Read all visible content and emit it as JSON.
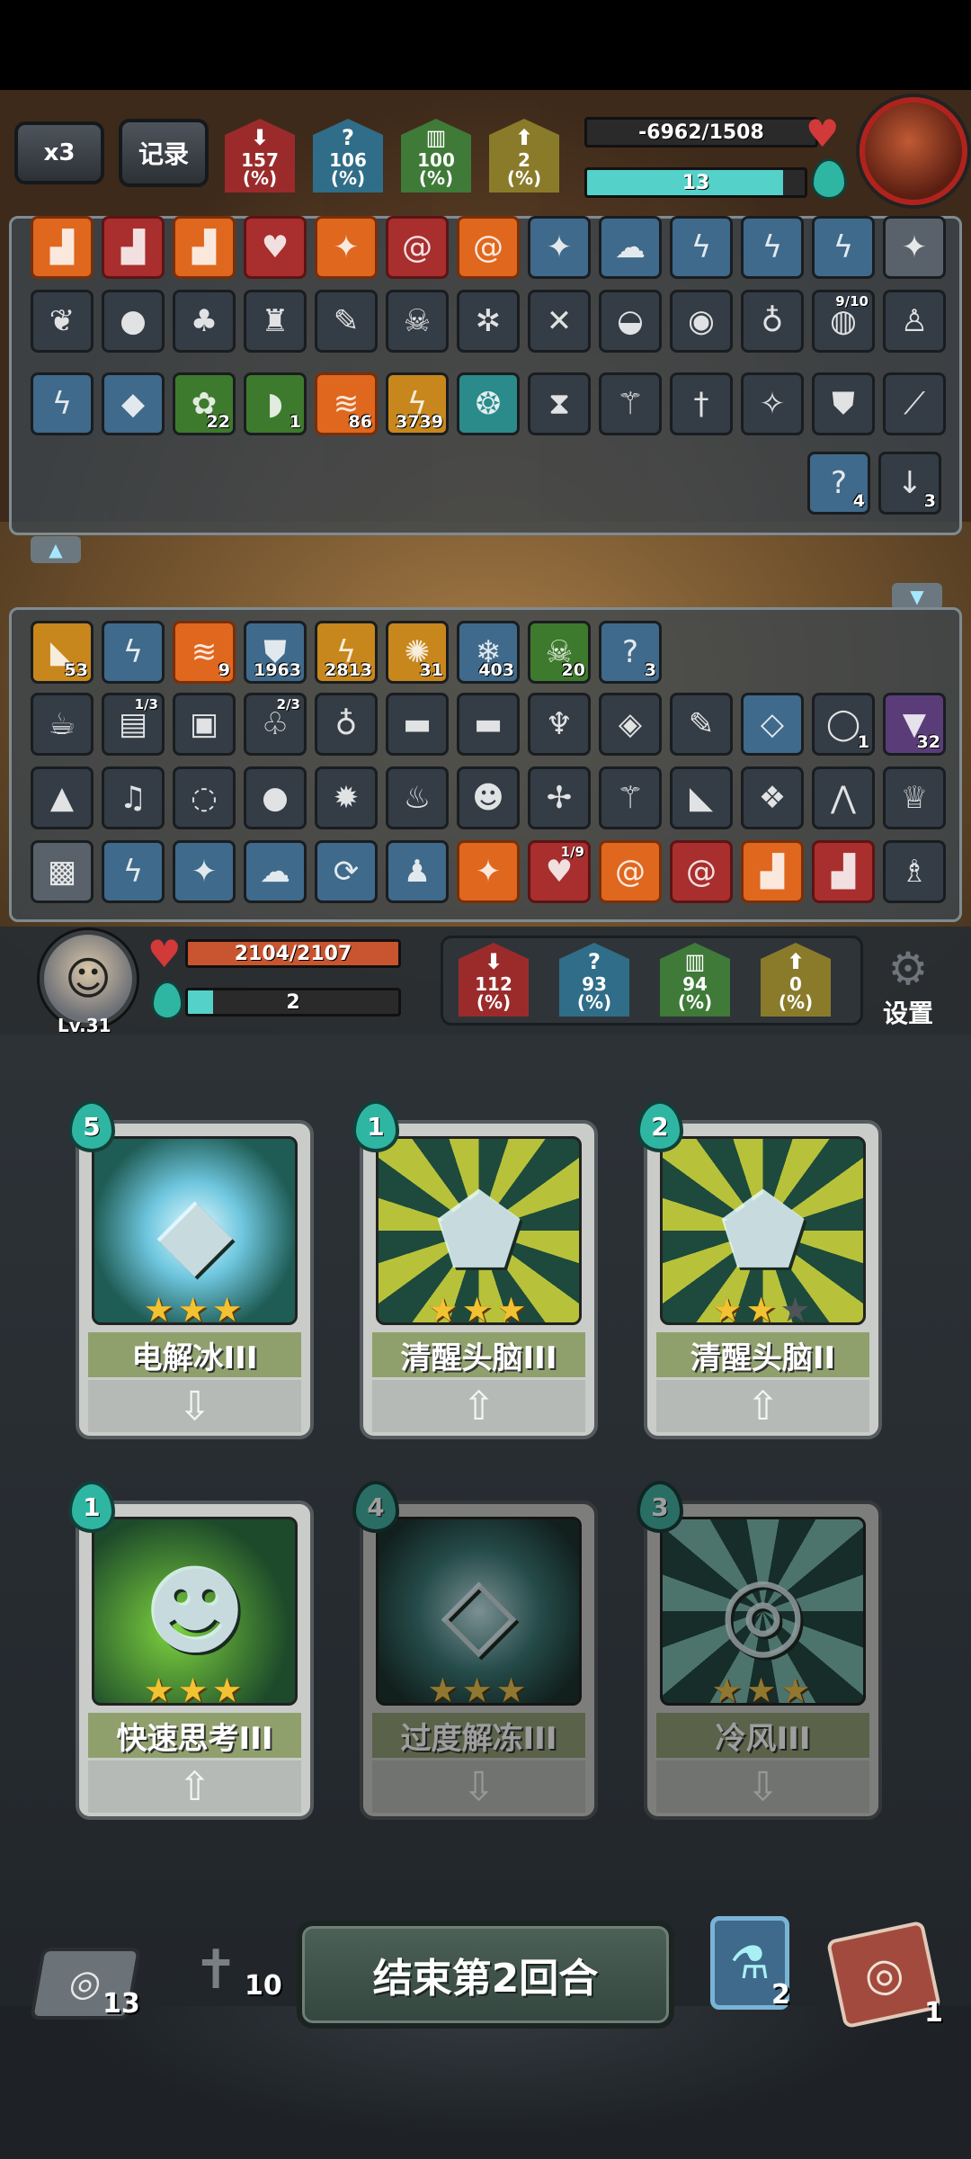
{
  "header": {
    "speed_label": "x3",
    "record_label": "记录"
  },
  "enemy": {
    "stats": [
      {
        "name": "attack",
        "value": "157",
        "unit": "(%)",
        "color": "#9b2b2b"
      },
      {
        "name": "crit",
        "value": "106",
        "unit": "(%)",
        "color": "#2f6d88"
      },
      {
        "name": "defense",
        "value": "100",
        "unit": "(%)",
        "color": "#3f7a38"
      },
      {
        "name": "dodge",
        "value": "2",
        "unit": "(%)",
        "color": "#8a7b2a"
      }
    ],
    "hp_text": "-6962/1508",
    "hp_fraction": 0.0,
    "mana_text": "13",
    "mana_fraction": 0.9,
    "heart_icon": "heart-icon",
    "mana_icon": "mana-flame-icon"
  },
  "enemy_items": {
    "row0": [
      {
        "icon": "boot-icon",
        "tone": "orange"
      },
      {
        "icon": "boot-icon",
        "tone": "red"
      },
      {
        "icon": "boot-icon",
        "tone": "orange"
      },
      {
        "icon": "heart-shard-icon",
        "tone": "red"
      },
      {
        "icon": "rune-icon",
        "tone": "orange"
      },
      {
        "icon": "swirl-icon",
        "tone": "red"
      },
      {
        "icon": "swirl-icon",
        "tone": "orange"
      },
      {
        "icon": "rune-icon",
        "tone": "blue"
      },
      {
        "icon": "cloud-icon",
        "tone": "blue"
      },
      {
        "icon": "lightning-icon",
        "tone": "blue"
      },
      {
        "icon": "lightning-icon",
        "tone": "blue"
      },
      {
        "icon": "lightning-icon",
        "tone": "blue"
      },
      {
        "icon": "rune-icon",
        "tone": "grey"
      }
    ],
    "row1": [
      {
        "icon": "wing-icon"
      },
      {
        "icon": "bomb-icon"
      },
      {
        "icon": "sack-icon"
      },
      {
        "icon": "potion-icon"
      },
      {
        "icon": "scroll-icon"
      },
      {
        "icon": "skull-icon"
      },
      {
        "icon": "mechanism-icon"
      },
      {
        "icon": "bone-icon"
      },
      {
        "icon": "bowl-icon"
      },
      {
        "icon": "owl-icon"
      },
      {
        "icon": "vial-icon"
      },
      {
        "icon": "turtle-icon",
        "frac": "9/10"
      },
      {
        "icon": "totem-icon"
      }
    ],
    "row2": [
      {
        "icon": "lightning-icon",
        "tone": "blue"
      },
      {
        "icon": "ice-icon",
        "tone": "blue"
      },
      {
        "icon": "poison-icon",
        "tone": "green",
        "count": "22"
      },
      {
        "icon": "slime-icon",
        "tone": "green",
        "count": "1"
      },
      {
        "icon": "fire-icon",
        "tone": "orange",
        "count": "86"
      },
      {
        "icon": "thunder-icon",
        "tone": "gold",
        "count": "3739"
      },
      {
        "icon": "orb-icon",
        "tone": "teal"
      },
      {
        "icon": "hourglass-icon"
      },
      {
        "icon": "staff-icon"
      },
      {
        "icon": "dagger-icon"
      },
      {
        "icon": "wand-icon"
      },
      {
        "icon": "shield-icon"
      },
      {
        "icon": "feather-icon"
      }
    ],
    "row3": [
      {
        "icon": "ghost-icon",
        "tone": "blue",
        "count": "4"
      },
      {
        "icon": "down-arrow-icon",
        "tone": "dark",
        "count": "3"
      }
    ]
  },
  "player_items": {
    "row0": [
      {
        "icon": "horn-icon",
        "tone": "gold",
        "count": "53"
      },
      {
        "icon": "lightning-icon",
        "tone": "blue"
      },
      {
        "icon": "fire-icon",
        "tone": "orange",
        "count": "9"
      },
      {
        "icon": "shield-icon",
        "tone": "blue",
        "count": "1963"
      },
      {
        "icon": "thunder-icon",
        "tone": "gold",
        "count": "2813"
      },
      {
        "icon": "spark-icon",
        "tone": "gold",
        "count": "31"
      },
      {
        "icon": "snowflake-icon",
        "tone": "blue",
        "count": "403"
      },
      {
        "icon": "skull-icon",
        "tone": "green",
        "count": "20"
      },
      {
        "icon": "ghost-icon",
        "tone": "blue",
        "count": "3"
      }
    ],
    "row1": [
      {
        "icon": "teacup-icon"
      },
      {
        "icon": "book-icon",
        "frac": "1/3"
      },
      {
        "icon": "tome-icon"
      },
      {
        "icon": "plant-icon",
        "frac": "2/3"
      },
      {
        "icon": "vial-icon"
      },
      {
        "icon": "dynamite-icon"
      },
      {
        "icon": "dynamite-icon"
      },
      {
        "icon": "brush-icon"
      },
      {
        "icon": "gem-icon"
      },
      {
        "icon": "scroll-icon"
      },
      {
        "icon": "crystal-icon",
        "tone": "blue"
      },
      {
        "icon": "ward-icon",
        "tone": "dark",
        "count": "1"
      },
      {
        "icon": "curse-icon",
        "tone": "purple",
        "count": "32"
      }
    ],
    "row2": [
      {
        "icon": "riceball-icon"
      },
      {
        "icon": "bell-icon"
      },
      {
        "icon": "coil-icon"
      },
      {
        "icon": "bomb-icon"
      },
      {
        "icon": "firebomb-icon"
      },
      {
        "icon": "flamecup-icon"
      },
      {
        "icon": "mask-icon"
      },
      {
        "icon": "crossbow-icon"
      },
      {
        "icon": "staff-icon"
      },
      {
        "icon": "horn-icon"
      },
      {
        "icon": "crystals-icon"
      },
      {
        "icon": "trap-icon"
      },
      {
        "icon": "witch-icon"
      }
    ],
    "row3": [
      {
        "icon": "save-icon",
        "tone": "grey"
      },
      {
        "icon": "lightning-icon",
        "tone": "blue"
      },
      {
        "icon": "rune-icon",
        "tone": "blue"
      },
      {
        "icon": "cloud-icon",
        "tone": "blue"
      },
      {
        "icon": "vortex-icon",
        "tone": "blue"
      },
      {
        "icon": "figure-icon",
        "tone": "blue"
      },
      {
        "icon": "rune-icon",
        "tone": "orange"
      },
      {
        "icon": "heart-shard-icon",
        "tone": "red",
        "frac": "1/9"
      },
      {
        "icon": "swirl-icon",
        "tone": "orange"
      },
      {
        "icon": "swirl-icon",
        "tone": "red"
      },
      {
        "icon": "boot-icon",
        "tone": "orange"
      },
      {
        "icon": "boot-icon",
        "tone": "red"
      },
      {
        "icon": "wizard-icon",
        "tone": "dark"
      }
    ]
  },
  "player": {
    "level": "Lv.31",
    "hp_text": "2104/2107",
    "hp_fraction": 0.998,
    "mana_text": "2",
    "mana_fraction": 0.12,
    "stats": [
      {
        "name": "attack",
        "value": "112",
        "unit": "(%)",
        "color": "#9b2b2b"
      },
      {
        "name": "crit",
        "value": "93",
        "unit": "(%)",
        "color": "#2f6d88"
      },
      {
        "name": "defense",
        "value": "94",
        "unit": "(%)",
        "color": "#3f7a38"
      },
      {
        "name": "dodge",
        "value": "0",
        "unit": "(%)",
        "color": "#8a7b2a"
      }
    ],
    "settings_label": "设置"
  },
  "cards": [
    {
      "name": "电解冰III",
      "cost": "5",
      "stars": 3,
      "art": "ice-cube-lightning-icon",
      "arrow": "down",
      "dim": false
    },
    {
      "name": "清醒头脑III",
      "cost": "1",
      "stars": 3,
      "art": "brain-rock-icon",
      "arrow": "up",
      "dim": false
    },
    {
      "name": "清醒头脑II",
      "cost": "2",
      "stars": 2,
      "art": "brain-rock-icon",
      "arrow": "up",
      "dim": false
    },
    {
      "name": "快速思考III",
      "cost": "1",
      "stars": 3,
      "art": "thinker-bulb-icon",
      "arrow": "up",
      "dim": false
    },
    {
      "name": "过度解冻III",
      "cost": "4",
      "stars": 3,
      "art": "melting-ice-icon",
      "arrow": "down",
      "dim": true
    },
    {
      "name": "冷风III",
      "cost": "3",
      "stars": 3,
      "art": "cold-wind-icon",
      "arrow": "down",
      "dim": true
    }
  ],
  "footer": {
    "draw_pile_count": "13",
    "discard_pile_count": "10",
    "end_turn_label": "结束第2回合",
    "potion_count": "2",
    "exhaust_pile_count": "1"
  }
}
